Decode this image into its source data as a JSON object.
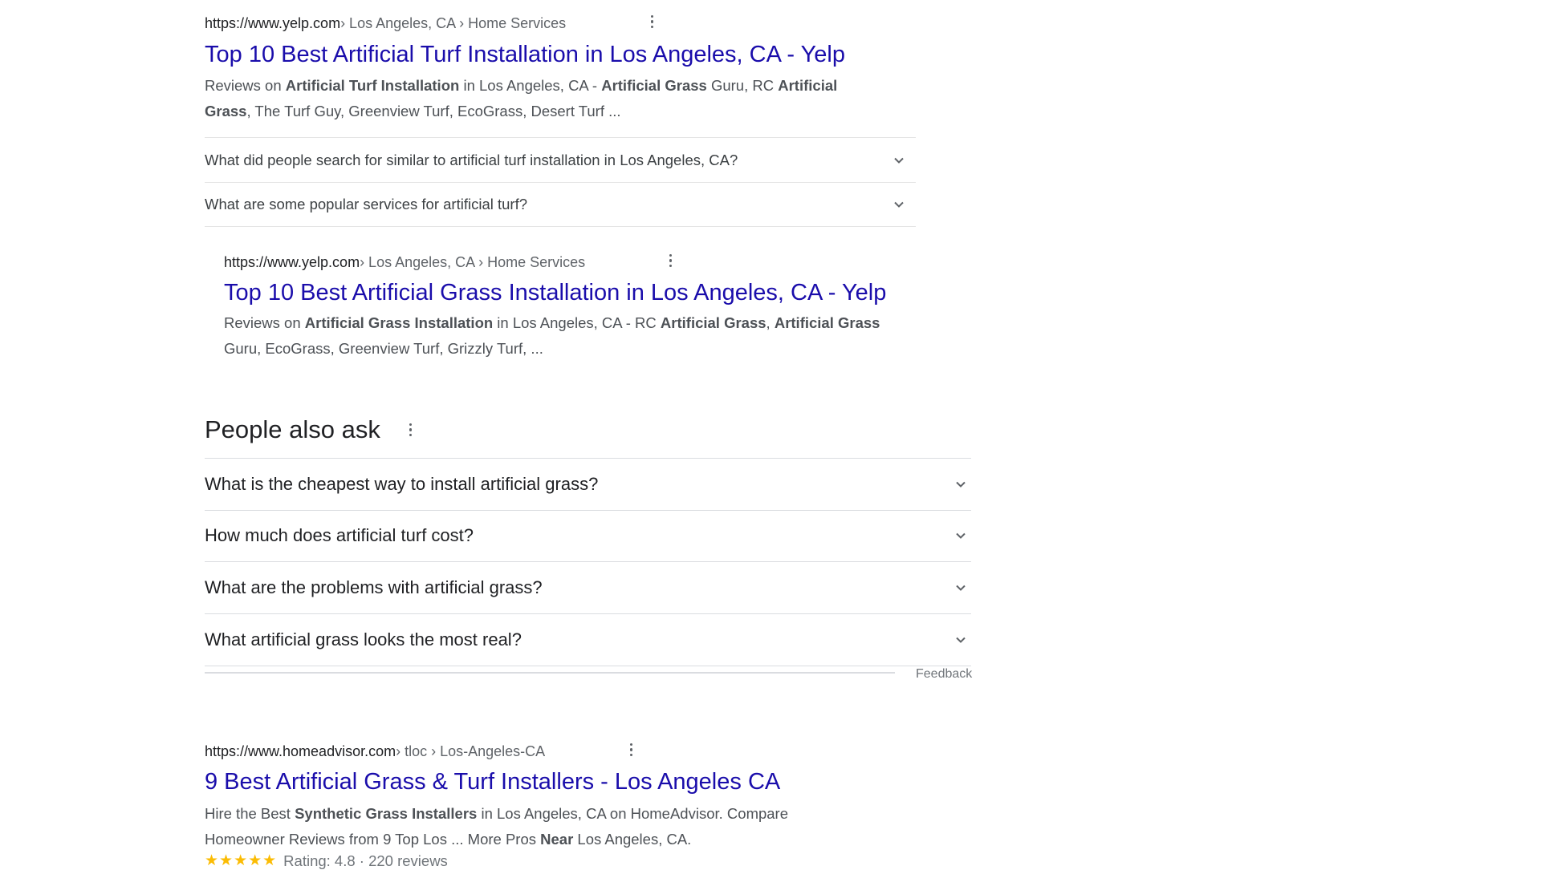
{
  "results": [
    {
      "url_domain": "https://www.yelp.com",
      "url_crumbs": " › Los Angeles, CA › Home Services",
      "title": "Top 10 Best Artificial Turf Installation in Los Angeles, CA - Yelp",
      "snippet_line1": [
        {
          "t": "Reviews on ",
          "b": false
        },
        {
          "t": "Artificial Turf Installation",
          "b": true
        },
        {
          "t": " in Los Angeles, CA - ",
          "b": false
        },
        {
          "t": "Artificial Grass",
          "b": true
        },
        {
          "t": " Guru, RC ",
          "b": false
        },
        {
          "t": "Artificial",
          "b": true
        }
      ],
      "snippet_line2": [
        {
          "t": "Grass",
          "b": true
        },
        {
          "t": ", The Turf Guy, Greenview Turf, EcoGrass, Desert Turf ...",
          "b": false
        }
      ],
      "related": [
        "What did people search for similar to artificial turf installation in Los Angeles, CA?",
        "What are some popular services for artificial turf?"
      ]
    },
    {
      "url_domain": "https://www.yelp.com",
      "url_crumbs": " › Los Angeles, CA › Home Services",
      "title": "Top 10 Best Artificial Grass Installation in Los Angeles, CA - Yelp",
      "snippet_line1": [
        {
          "t": "Reviews on ",
          "b": false
        },
        {
          "t": "Artificial Grass Installation",
          "b": true
        },
        {
          "t": " in Los Angeles, CA - RC ",
          "b": false
        },
        {
          "t": "Artificial Grass",
          "b": true
        },
        {
          "t": ", ",
          "b": false
        },
        {
          "t": "Artificial Grass",
          "b": true
        }
      ],
      "snippet_line2": [
        {
          "t": "Guru, EcoGrass, Greenview Turf, Grizzly Turf, ...",
          "b": false
        }
      ]
    },
    {
      "url_domain": "https://www.homeadvisor.com",
      "url_crumbs": " › tloc › Los-Angeles-CA",
      "title": "9 Best Artificial Grass & Turf Installers - Los Angeles CA",
      "snippet_line1": [
        {
          "t": "Hire the Best ",
          "b": false
        },
        {
          "t": "Synthetic Grass Installers",
          "b": true
        },
        {
          "t": " in Los Angeles, CA on HomeAdvisor. Compare",
          "b": false
        }
      ],
      "snippet_line2": [
        {
          "t": "Homeowner Reviews from 9 Top Los ... More Pros ",
          "b": false
        },
        {
          "t": "Near",
          "b": true
        },
        {
          "t": " Los Angeles, CA.",
          "b": false
        }
      ],
      "stars": "★★★★★",
      "rating_text": "Rating: 4.8 · 220 reviews"
    }
  ],
  "paa": {
    "heading": "People also ask",
    "questions": [
      "What is the cheapest way to install artificial grass?",
      "How much does artificial turf cost?",
      "What are the problems with artificial grass?",
      "What artificial grass looks the most real?"
    ],
    "feedback": "Feedback"
  },
  "icons": {
    "more": "more-vert-icon",
    "expand": "chevron-down-icon"
  },
  "colors": {
    "link": "#1a0dab",
    "star": "#fbbc04",
    "text": "#202124",
    "muted": "#70757a"
  }
}
